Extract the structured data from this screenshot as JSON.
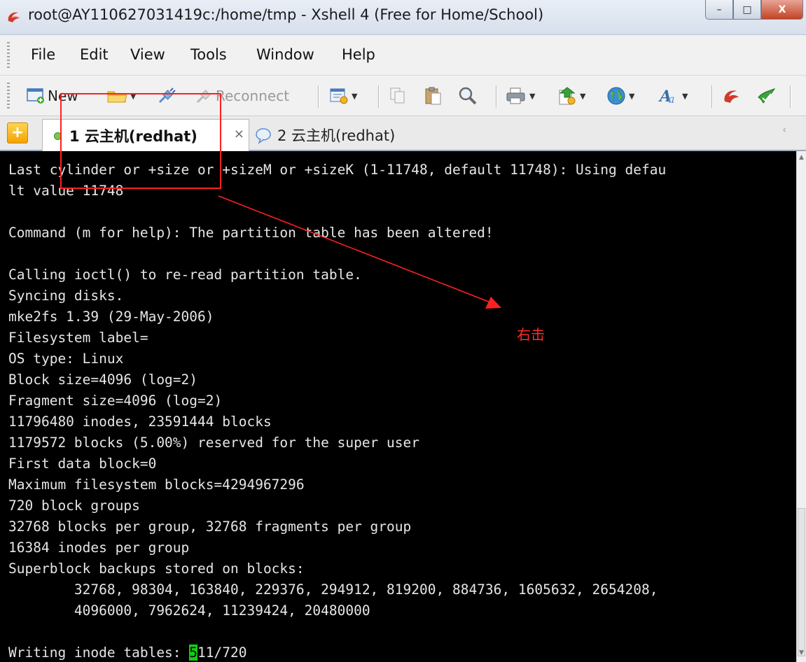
{
  "window": {
    "title": "root@AY110627031419c:/home/tmp - Xshell 4 (Free for Home/School)",
    "controls": {
      "minimize": "–",
      "maximize": "□",
      "close": "X"
    }
  },
  "menubar": {
    "items": [
      "File",
      "Edit",
      "View",
      "Tools",
      "Window",
      "Help"
    ]
  },
  "toolbar": {
    "new_label": "New",
    "reconnect_label": "Reconnect"
  },
  "tabs": {
    "add_symbol": "+",
    "tab1": {
      "label": "1 云主机(redhat)",
      "close": "×"
    },
    "tab2": {
      "label": "2 云主机(redhat)"
    },
    "scroll_arrow": "‹"
  },
  "terminal": {
    "lines": [
      "Last cylinder or +size or +sizeM or +sizeK (1-11748, default 11748): Using defau",
      "lt value 11748",
      "",
      "Command (m for help): The partition table has been altered!",
      "",
      "Calling ioctl() to re-read partition table.",
      "Syncing disks.",
      "mke2fs 1.39 (29-May-2006)",
      "Filesystem label=",
      "OS type: Linux",
      "Block size=4096 (log=2)",
      "Fragment size=4096 (log=2)",
      "11796480 inodes, 23591444 blocks",
      "1179572 blocks (5.00%) reserved for the super user",
      "First data block=0",
      "Maximum filesystem blocks=4294967296",
      "720 block groups",
      "32768 blocks per group, 32768 fragments per group",
      "16384 inodes per group",
      "Superblock backups stored on blocks:",
      "        32768, 98304, 163840, 229376, 294912, 819200, 884736, 1605632, 2654208,",
      "        4096000, 7962624, 11239424, 20480000",
      ""
    ],
    "last_line_prefix": "Writing inode tables: ",
    "cursor_char": "5",
    "last_line_suffix": "11/720"
  },
  "annotation": {
    "text": "右击",
    "color": "#ff2020"
  },
  "colors": {
    "terminal_bg": "#000000",
    "terminal_fg": "#e6e6e6",
    "cursor": "#10d010"
  }
}
